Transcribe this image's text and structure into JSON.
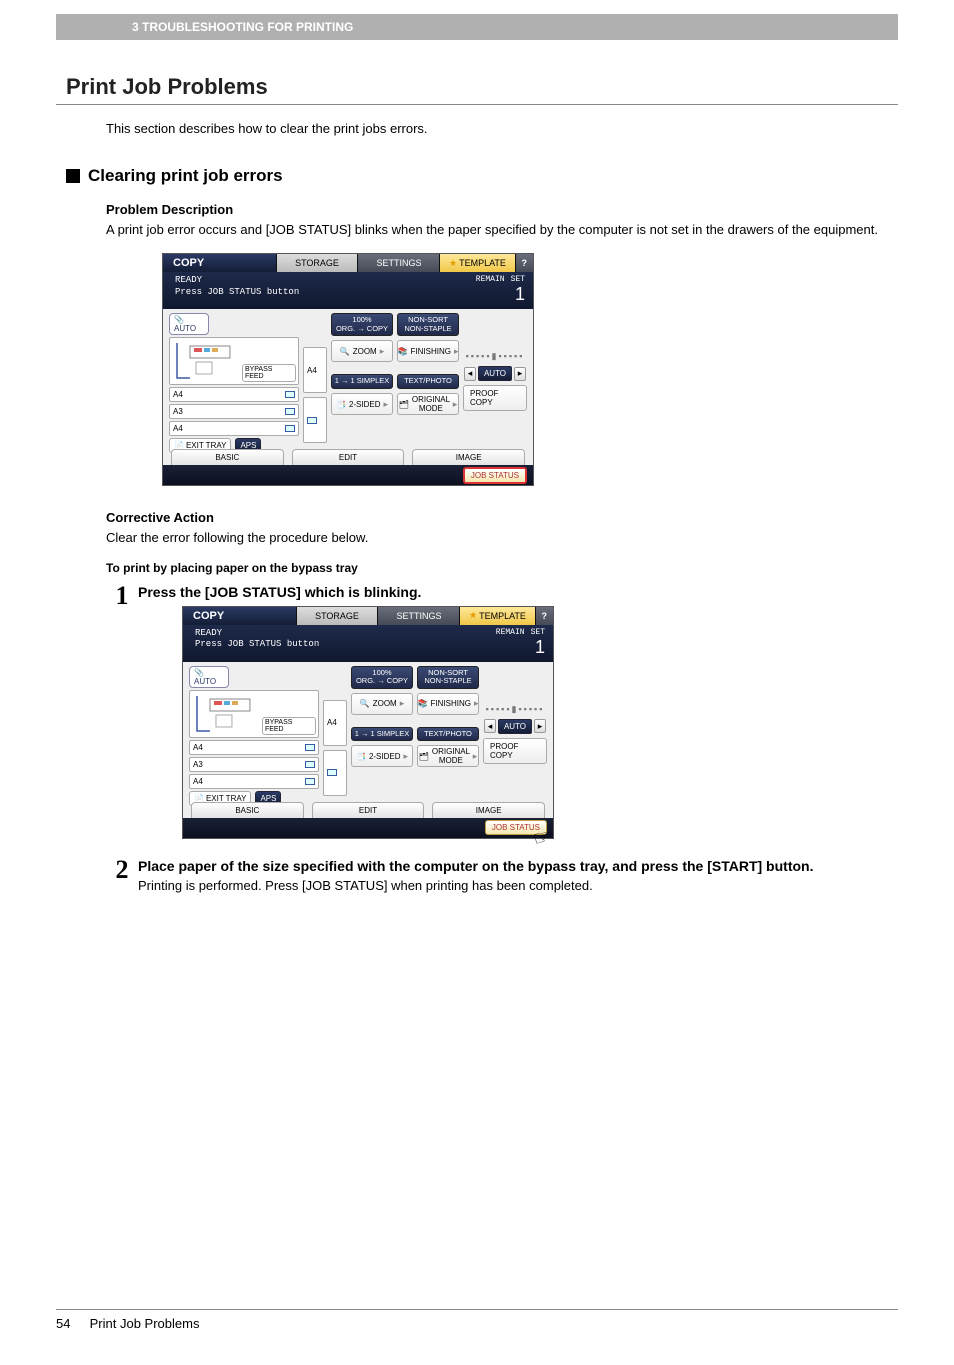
{
  "header": {
    "breadcrumb": "3 TROUBLESHOOTING FOR PRINTING"
  },
  "title": "Print Job Problems",
  "intro": "This section describes how to clear the print jobs errors.",
  "section": {
    "heading": "Clearing print job errors",
    "problem_label": "Problem Description",
    "problem_text": "A print job error occurs and [JOB STATUS] blinks when the paper specified by the computer is not set in the drawers of the equipment.",
    "corrective_label": "Corrective Action",
    "corrective_text": "Clear the error following the procedure below.",
    "method_label": "To print by placing paper on the bypass tray"
  },
  "steps": [
    {
      "num": "1",
      "title": "Press the [JOB STATUS] which is blinking.",
      "desc": ""
    },
    {
      "num": "2",
      "title": "Place paper of the size specified with the computer on the bypass tray, and press the [START] button.",
      "desc": "Printing is performed. Press [JOB STATUS] when printing has been completed."
    }
  ],
  "panel": {
    "top": {
      "copy": "COPY",
      "storage": "STORAGE",
      "settings": "SETTINGS",
      "template": "TEMPLATE",
      "help": "?"
    },
    "status": {
      "ready": "READY",
      "msg": "Press JOB STATUS button",
      "remain": "REMAIN",
      "set": "SET",
      "count": "1"
    },
    "left": {
      "auto": "AUTO",
      "a4": "A4",
      "a3": "A3",
      "a4b": "A4",
      "bypass": "BYPASS\nFEED",
      "exit": "EXIT\nTRAY",
      "aps": "APS"
    },
    "mid1": {
      "zoom_hdr1": "100%",
      "zoom_hdr2": "ORG.  → COPY",
      "zoom": "ZOOM",
      "simplex_hdr": "1 → 1\nSIMPLEX",
      "twosided": "2-SIDED"
    },
    "mid2": {
      "sort": "NON-SORT\nNON-STAPLE",
      "finishing": "FINISHING",
      "textphoto": "TEXT/PHOTO",
      "origmode": "ORIGINAL\nMODE"
    },
    "right": {
      "auto": "AUTO",
      "proof": "PROOF COPY"
    },
    "tabs": {
      "basic": "BASIC",
      "edit": "EDIT",
      "image": "IMAGE"
    },
    "footer": {
      "jobstatus": "JOB STATUS"
    }
  },
  "footer": {
    "page": "54",
    "label": "Print Job Problems"
  }
}
